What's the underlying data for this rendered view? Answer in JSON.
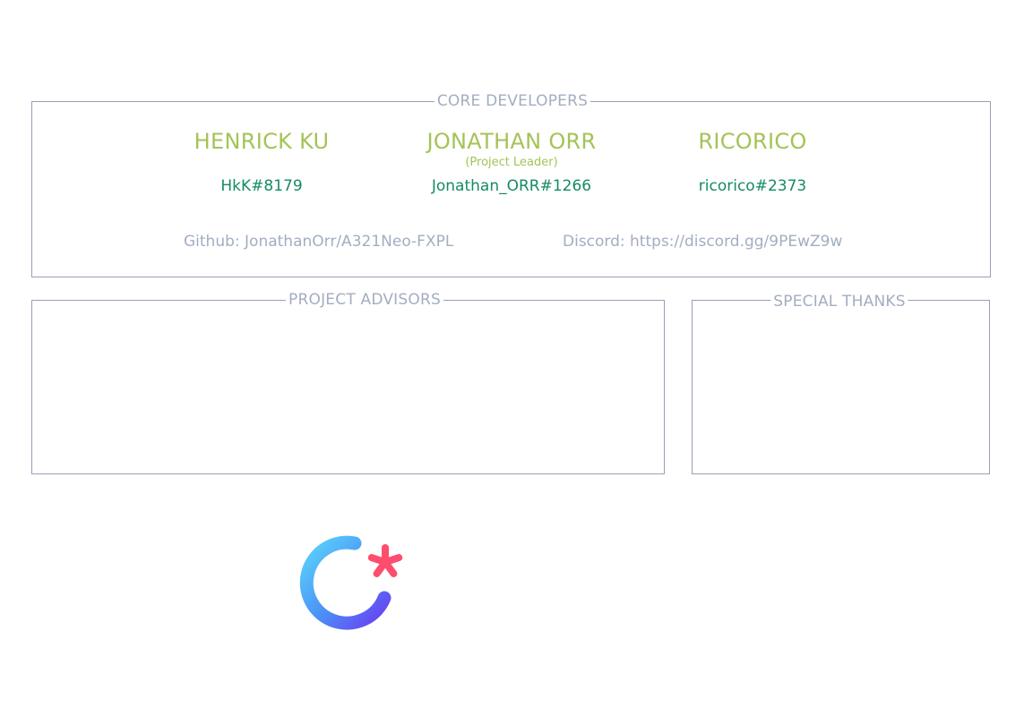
{
  "core_developers": {
    "title": "CORE DEVELOPERS",
    "developers": [
      {
        "name": "HENRICK KU",
        "role": "",
        "handle": "HkK#8179"
      },
      {
        "name": "JONATHAN ORR",
        "role": "(Project Leader)",
        "handle": "Jonathan_ORR#1266"
      },
      {
        "name": "RICORICO",
        "role": "",
        "handle": "ricorico#2373"
      }
    ],
    "github": "Github: JonathanOrr/A321Neo-FXPL",
    "discord": "Discord: https://discord.gg/9PEwZ9w"
  },
  "project_advisors": {
    "title": "PROJECT ADVISORS"
  },
  "special_thanks": {
    "title": "SPECIAL THANKS"
  },
  "logo": {
    "icon": "loading-spinner-star-icon",
    "colors": {
      "ring_start": "#5ad4fb",
      "ring_end": "#6a3cf2",
      "star": "#ff4d6d"
    }
  }
}
